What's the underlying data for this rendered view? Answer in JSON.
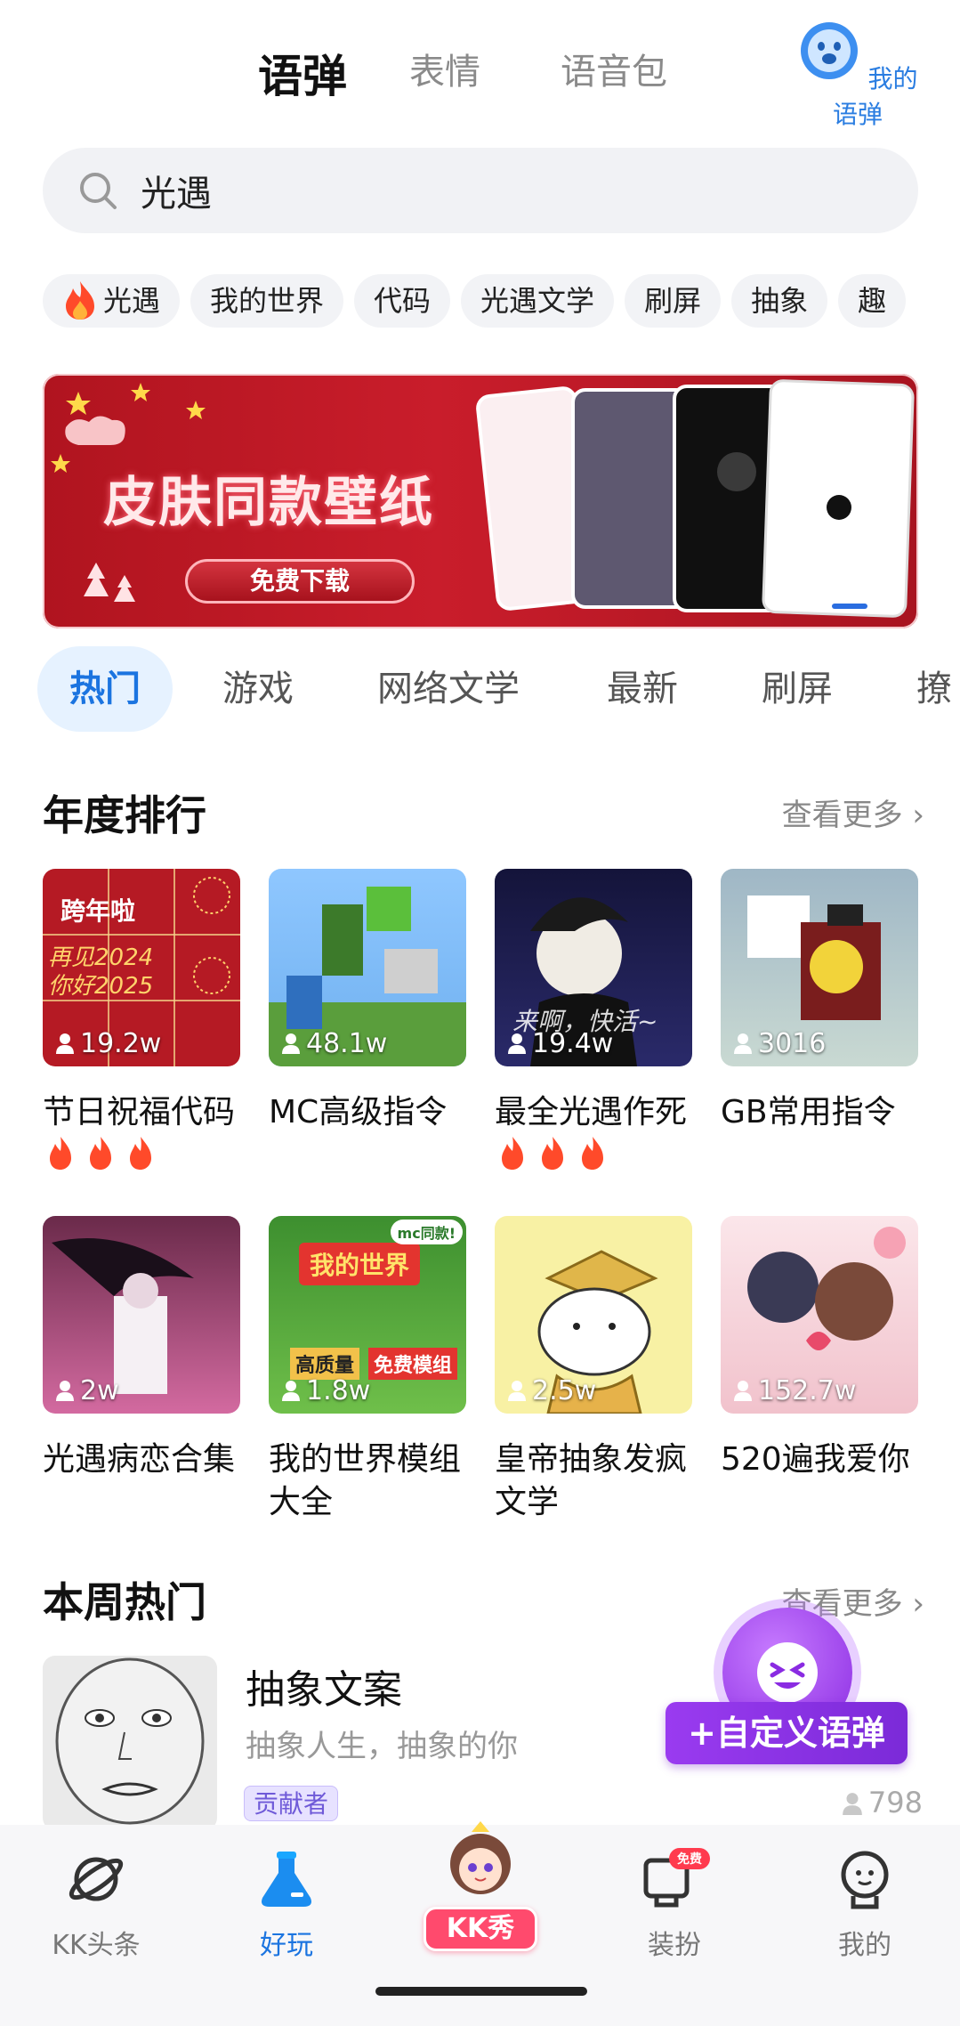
{
  "header": {
    "tabs": [
      {
        "label": "语弹",
        "active": true
      },
      {
        "label": "表情",
        "active": false
      },
      {
        "label": "语音包",
        "active": false
      }
    ],
    "my_danmu_label": "我的语弹"
  },
  "search": {
    "value": "光遇",
    "icon": "search-icon"
  },
  "chips": [
    {
      "label": "光遇",
      "icon": "fire-icon"
    },
    {
      "label": "我的世界"
    },
    {
      "label": "代码"
    },
    {
      "label": "光遇文学"
    },
    {
      "label": "刷屏"
    },
    {
      "label": "抽象"
    },
    {
      "label": "趣"
    }
  ],
  "banner": {
    "title": "皮肤同款壁纸",
    "button": "免费下载"
  },
  "categories": [
    {
      "label": "热门",
      "active": true
    },
    {
      "label": "游戏"
    },
    {
      "label": "网络文学"
    },
    {
      "label": "最新"
    },
    {
      "label": "刷屏"
    },
    {
      "label": "撩"
    }
  ],
  "annual": {
    "title": "年度排行",
    "more": "查看更多",
    "items": [
      {
        "title": "节日祝福代码",
        "count": "19.2w",
        "fires": true,
        "thumb_caption": "跨年啦",
        "thumb_text": "再见2024 你好2025"
      },
      {
        "title": "MC高级指令",
        "count": "48.1w"
      },
      {
        "title": "最全光遇作死",
        "count": "19.4w",
        "fires": true,
        "thumb_caption": "来啊，快活~"
      },
      {
        "title": "GB常用指令",
        "count": "3016"
      },
      {
        "title": "光遇病恋合集",
        "count": "2w"
      },
      {
        "title": "我的世界模组大全",
        "count": "1.8w",
        "thumb_caption": "我的世界",
        "thumb_badge": "mc同款!",
        "thumb_tags": [
          "高质量",
          "免费模组"
        ]
      },
      {
        "title": "皇帝抽象发疯文学",
        "count": "2.5w"
      },
      {
        "title": "520遍我爱你",
        "count": "152.7w"
      }
    ]
  },
  "weekly": {
    "title": "本周热门",
    "more": "查看更多",
    "item": {
      "title": "抽象文案",
      "subtitle": "抽象人生，抽象的你",
      "badge": "贡献者",
      "count": "798"
    }
  },
  "fab": {
    "label": "+自定义语弹"
  },
  "bottom_nav": [
    {
      "label": "KK头条",
      "icon": "planet-icon"
    },
    {
      "label": "好玩",
      "icon": "flask-icon",
      "active": true
    },
    {
      "label": "KK秀",
      "icon": "avatar-icon"
    },
    {
      "label": "装扮",
      "icon": "dressup-icon",
      "badge": "免费"
    },
    {
      "label": "我的",
      "icon": "profile-icon"
    }
  ],
  "colors": {
    "accent": "#1b74e0",
    "highlight": "#ffd84a",
    "banner": "#c91d2b",
    "fab": "#8a2be2"
  }
}
